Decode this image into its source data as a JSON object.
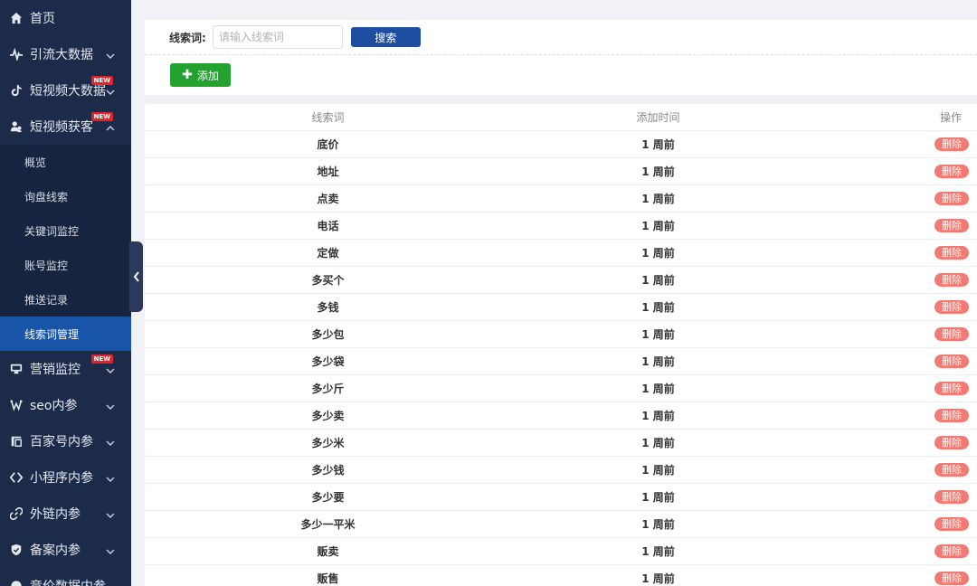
{
  "sidebar": {
    "items": [
      {
        "label": "首页",
        "icon": "home-icon"
      },
      {
        "label": "引流大数据",
        "icon": "pulse-icon"
      },
      {
        "label": "短视频大数据",
        "icon": "tiktok-icon",
        "badge": "NEW"
      },
      {
        "label": "短视频获客",
        "icon": "users-icon",
        "badge": "NEW"
      },
      {
        "label": "营销监控",
        "icon": "monitor-icon",
        "badge": "NEW"
      },
      {
        "label": "seo内参",
        "icon": "seo-icon"
      },
      {
        "label": "百家号内参",
        "icon": "baijiahao-icon"
      },
      {
        "label": "小程序内参",
        "icon": "miniprogram-icon"
      },
      {
        "label": "外链内参",
        "icon": "link-icon"
      },
      {
        "label": "备案内参",
        "icon": "shield-icon"
      },
      {
        "label": "竞价数据内参",
        "icon": "bid-icon"
      }
    ],
    "submenu": [
      {
        "label": "概览"
      },
      {
        "label": "询盘线索"
      },
      {
        "label": "关键词监控"
      },
      {
        "label": "账号监控"
      },
      {
        "label": "推送记录"
      },
      {
        "label": "线索词管理",
        "active": true
      }
    ]
  },
  "search": {
    "label": "线索词:",
    "placeholder": "请输入线索词",
    "value": "",
    "button": "搜索"
  },
  "toolbar": {
    "add_label": "添加"
  },
  "table": {
    "headers": [
      "线索词",
      "添加时间",
      "操作"
    ],
    "delete_label": "删除",
    "rows": [
      {
        "word": "底价",
        "time": "1 周前"
      },
      {
        "word": "地址",
        "time": "1 周前"
      },
      {
        "word": "点卖",
        "time": "1 周前"
      },
      {
        "word": "电话",
        "time": "1 周前"
      },
      {
        "word": "定做",
        "time": "1 周前"
      },
      {
        "word": "多买个",
        "time": "1 周前"
      },
      {
        "word": "多钱",
        "time": "1 周前"
      },
      {
        "word": "多少包",
        "time": "1 周前"
      },
      {
        "word": "多少袋",
        "time": "1 周前"
      },
      {
        "word": "多少斤",
        "time": "1 周前"
      },
      {
        "word": "多少卖",
        "time": "1 周前"
      },
      {
        "word": "多少米",
        "time": "1 周前"
      },
      {
        "word": "多少钱",
        "time": "1 周前"
      },
      {
        "word": "多少要",
        "time": "1 周前"
      },
      {
        "word": "多少一平米",
        "time": "1 周前"
      },
      {
        "word": "贩卖",
        "time": "1 周前"
      },
      {
        "word": "贩售",
        "time": "1 周前"
      }
    ]
  },
  "colors": {
    "sidebar_bg": "#1d2b4a",
    "active_item": "#1854a8",
    "search_button": "#1d4ea0",
    "add_button": "#23a22f",
    "delete_button": "#f27a72",
    "badge": "#e0242b"
  }
}
